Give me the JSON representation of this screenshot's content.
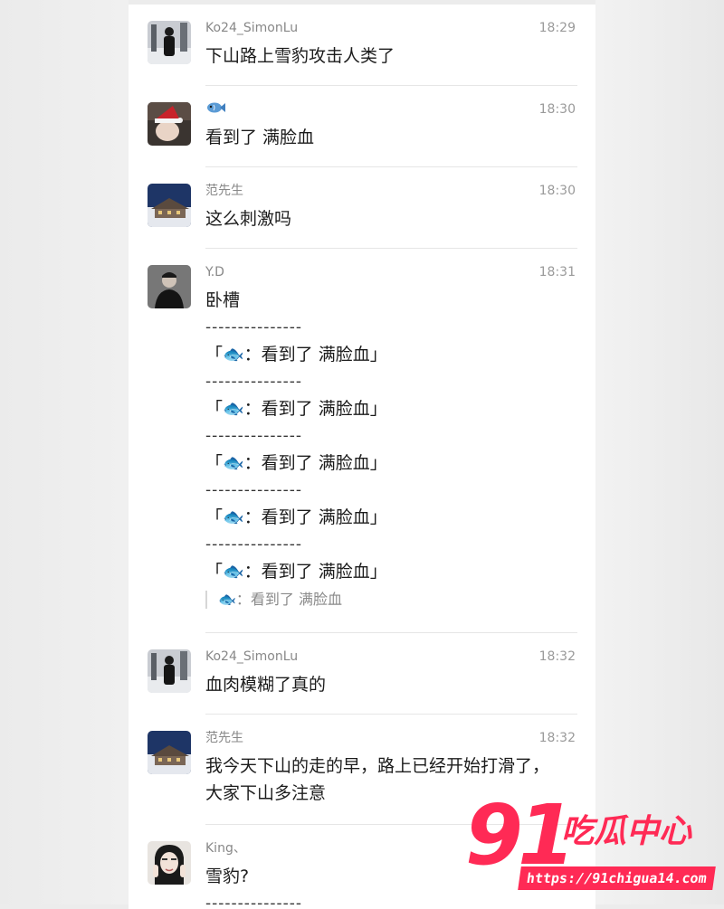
{
  "messages": [
    {
      "avatar": "person-in-snow",
      "name": "Ko24_SimonLu",
      "time": "18:29",
      "text": "下山路上雪豹攻击人类了"
    },
    {
      "avatar": "santa-hat-selfie",
      "name": "🐟",
      "time": "18:30",
      "text": "看到了 满脸血"
    },
    {
      "avatar": "snowy-lodge",
      "name": "范先生",
      "time": "18:30",
      "text": "这么刺激吗"
    },
    {
      "avatar": "man-portrait",
      "name": "Y.D",
      "time": "18:31",
      "text": "卧槽",
      "divider": "---------------",
      "quotes": [
        "「🐟：看到了 满脸血」",
        "「🐟：看到了 满脸血」",
        "「🐟：看到了 满脸血」",
        "「🐟：看到了 满脸血」",
        "「🐟：看到了 满脸血」"
      ],
      "reference": "🐟：看到了 满脸血"
    },
    {
      "avatar": "person-in-snow",
      "name": "Ko24_SimonLu",
      "time": "18:32",
      "text": "血肉模糊了真的"
    },
    {
      "avatar": "snowy-lodge",
      "name": "范先生",
      "time": "18:32",
      "text": "我今天下山的走的早，路上已经开始打滑了，大家下山多注意",
      "text_line1": "我今天下山的走的早，路上已经开始打滑了，",
      "text_line2": "大家下山多注意"
    },
    {
      "avatar": "girl-portrait",
      "name": "King、",
      "time": "",
      "text": "雪豹?",
      "divider": "---------------"
    }
  ],
  "watermark": {
    "number": "91",
    "title": "吃瓜中心",
    "url": "https://91chigua14.com"
  },
  "colors": {
    "accent": "#ff2a55",
    "name_text": "#888888",
    "divider": "#e6e6e6",
    "panel_bg": "#ffffff"
  },
  "icons": {
    "fish": "fish-emoji-icon"
  }
}
